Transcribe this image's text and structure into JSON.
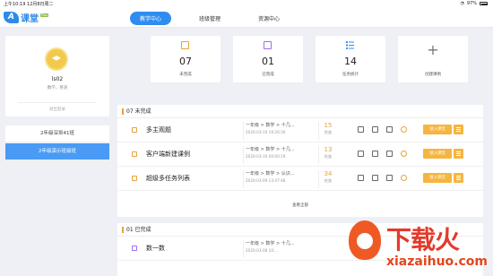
{
  "status": {
    "time": "上午10:19",
    "date": "12月8日周二",
    "battery": "97%"
  },
  "app": {
    "logo_mark": "A",
    "name": "课堂",
    "badge": "Plus"
  },
  "nav": {
    "tabs": [
      "教学中心",
      "班级管理",
      "资源中心"
    ],
    "active": 0
  },
  "profile": {
    "name": "ls02",
    "subjects": "数学，英语",
    "logout": "退出登录"
  },
  "classes": [
    "2年级深圳41班",
    "2年级演示班级班"
  ],
  "stats": [
    {
      "value": "07",
      "label": "未完成",
      "icon": "task-todo-icon"
    },
    {
      "value": "01",
      "label": "已完成",
      "icon": "task-done-icon"
    },
    {
      "value": "14",
      "label": "任务统计",
      "icon": "list-stats-icon"
    },
    {
      "value": "",
      "label": "创建课例",
      "icon": "plus-icon"
    }
  ],
  "incomplete": {
    "title": "07  未完成",
    "rows": [
      {
        "title": "多主观题",
        "path": "一年级 > 数学 > 十几...",
        "time": "2020-03-10 19:26:30",
        "count": "15",
        "count_label": "任务",
        "enter": "进入课堂"
      },
      {
        "title": "客户端新建课例",
        "path": "一年级 > 数学 > 十几...",
        "time": "2020-03-10 00:00:19",
        "count": "13",
        "count_label": "任务",
        "enter": "进入课堂"
      },
      {
        "title": "超级多任务列表",
        "path": "一年级 > 数学 > 认识...",
        "time": "2020-03-09 13:47:48",
        "count": "34",
        "count_label": "任务",
        "enter": "进入课堂"
      }
    ],
    "see_all": "查看全部"
  },
  "complete": {
    "title": "01  已完成",
    "rows": [
      {
        "title": "数一数",
        "path": "一年级 > 数学 > 十几...",
        "time": "2020-03-08 10:..."
      }
    ]
  },
  "watermark": {
    "cn": "下载火",
    "py": "xiazaihuo.com"
  },
  "colors": {
    "accent": "#2f8cf0",
    "orange": "#f5b53f",
    "purple": "#9b6cf0"
  }
}
